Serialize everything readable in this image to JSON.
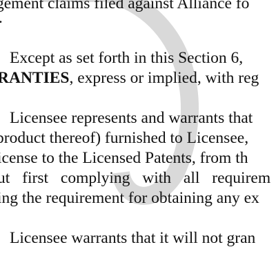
{
  "document": {
    "lines": {
      "l1": "gement claims filed against Alliance fo",
      "l2": ".",
      "l3": "Except as set forth in this Section 6,",
      "l4_bold": "RANTIES",
      "l4_rest": ", express or implied, with reg",
      "l5": "Licensee represents and warrants that",
      "l6": "product thereof) furnished to Licensee,",
      "l7": "icense to the Licensed Patents, from th",
      "l8": "ut first complying with all requirem",
      "l9": "ing the requirement for obtaining any ex",
      "l10": "Licensee warrants that it will not gran"
    }
  }
}
